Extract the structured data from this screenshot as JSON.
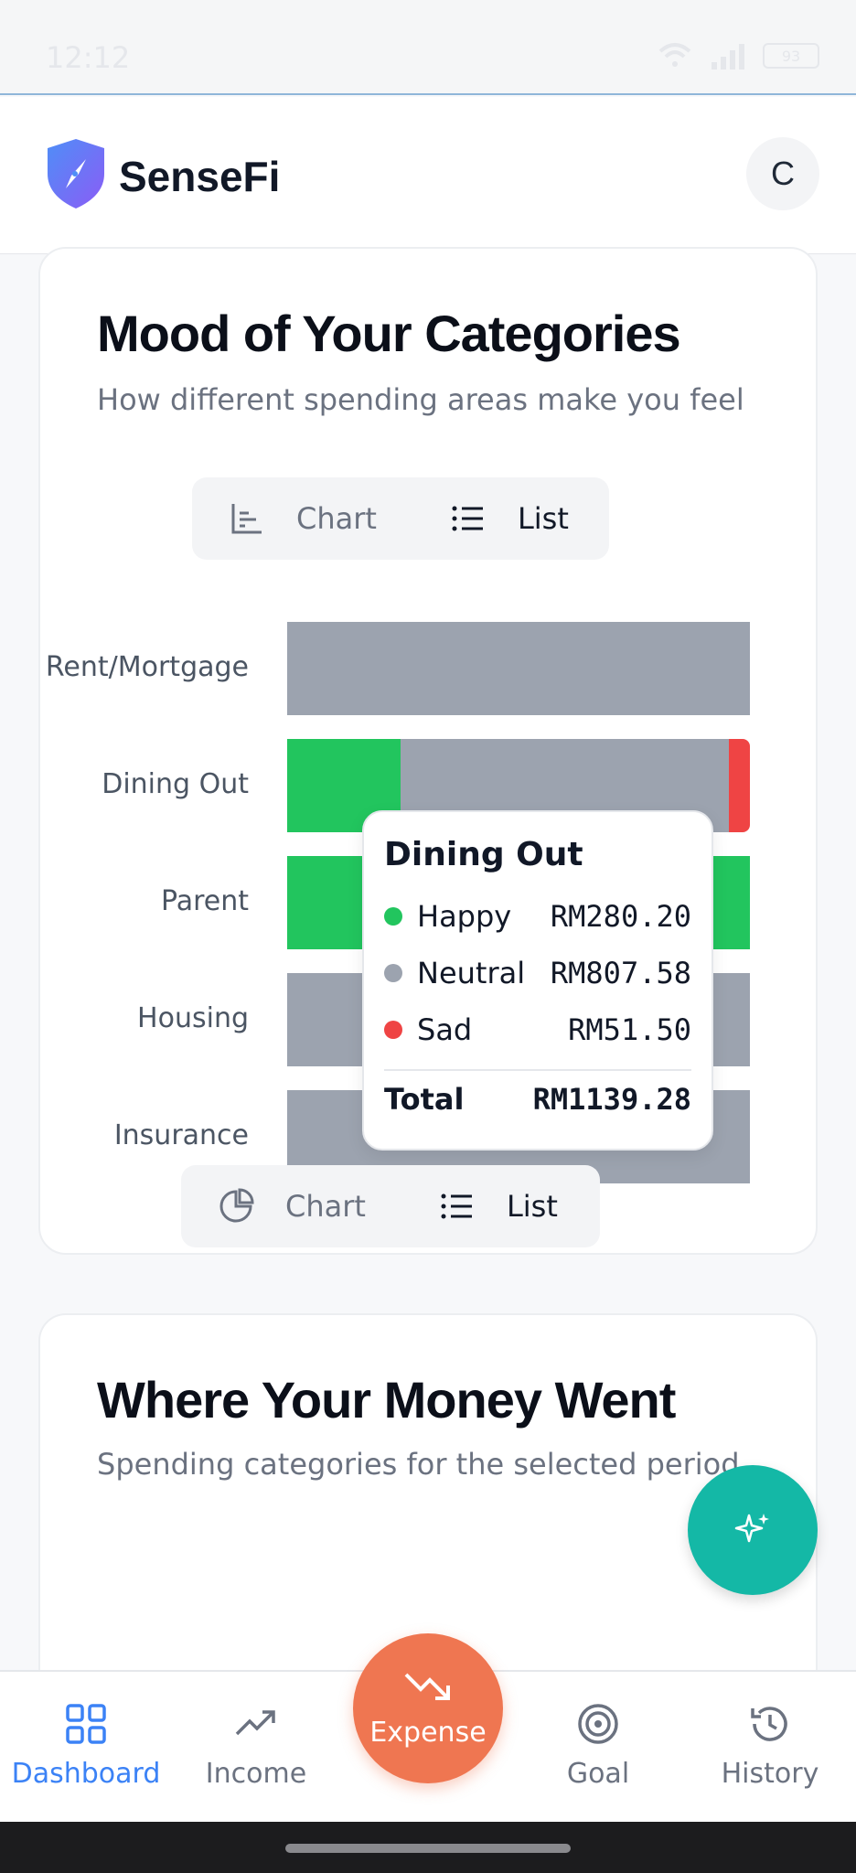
{
  "status_bar": {
    "time": "12:12",
    "battery": "93"
  },
  "header": {
    "brand": "SenseFi",
    "avatar_initial": "C"
  },
  "mood_card": {
    "title": "Mood of Your Categories",
    "subtitle": "How different spending areas make you feel",
    "toggle": {
      "chart_label": "Chart",
      "list_label": "List",
      "active": "list"
    },
    "chart_data": {
      "type": "bar",
      "orientation": "horizontal-stacked",
      "categories": [
        "Rent/Mortgage",
        "Dining Out",
        "Parent",
        "Housing",
        "Insurance"
      ],
      "series": [
        {
          "name": "Happy",
          "color": "#22c55e",
          "values": [
            0,
            280.2,
            1,
            0,
            0
          ]
        },
        {
          "name": "Neutral",
          "color": "#9ca3af",
          "values": [
            1,
            807.58,
            0,
            1,
            1
          ]
        },
        {
          "name": "Sad",
          "color": "#ef4444",
          "values": [
            0,
            51.5,
            0,
            0,
            0
          ]
        }
      ],
      "normalized": true
    },
    "tooltip": {
      "title": "Dining Out",
      "rows": [
        {
          "name": "Happy",
          "value": "RM280.20",
          "color": "#22c55e"
        },
        {
          "name": "Neutral",
          "value": "RM807.58",
          "color": "#9ca3af"
        },
        {
          "name": "Sad",
          "value": "RM51.50",
          "color": "#ef4444"
        }
      ],
      "total_label": "Total",
      "total_value": "RM1139.28"
    }
  },
  "money_card": {
    "title": "Where Your Money Went",
    "subtitle": "Spending categories for the selected period",
    "toggle": {
      "chart_label": "Chart",
      "list_label": "List",
      "active": "list"
    }
  },
  "nav": {
    "items": [
      {
        "label": "Dashboard",
        "icon": "grid-icon",
        "active": true
      },
      {
        "label": "Income",
        "icon": "trending-up-icon",
        "active": false
      },
      {
        "label": "Expense",
        "icon": "trending-down-icon",
        "active": false
      },
      {
        "label": "Goal",
        "icon": "target-icon",
        "active": false
      },
      {
        "label": "History",
        "icon": "history-icon",
        "active": false
      }
    ]
  },
  "colors": {
    "accent": "#3b82f6",
    "expense": "#ef7651",
    "fab": "#14b8a6"
  }
}
